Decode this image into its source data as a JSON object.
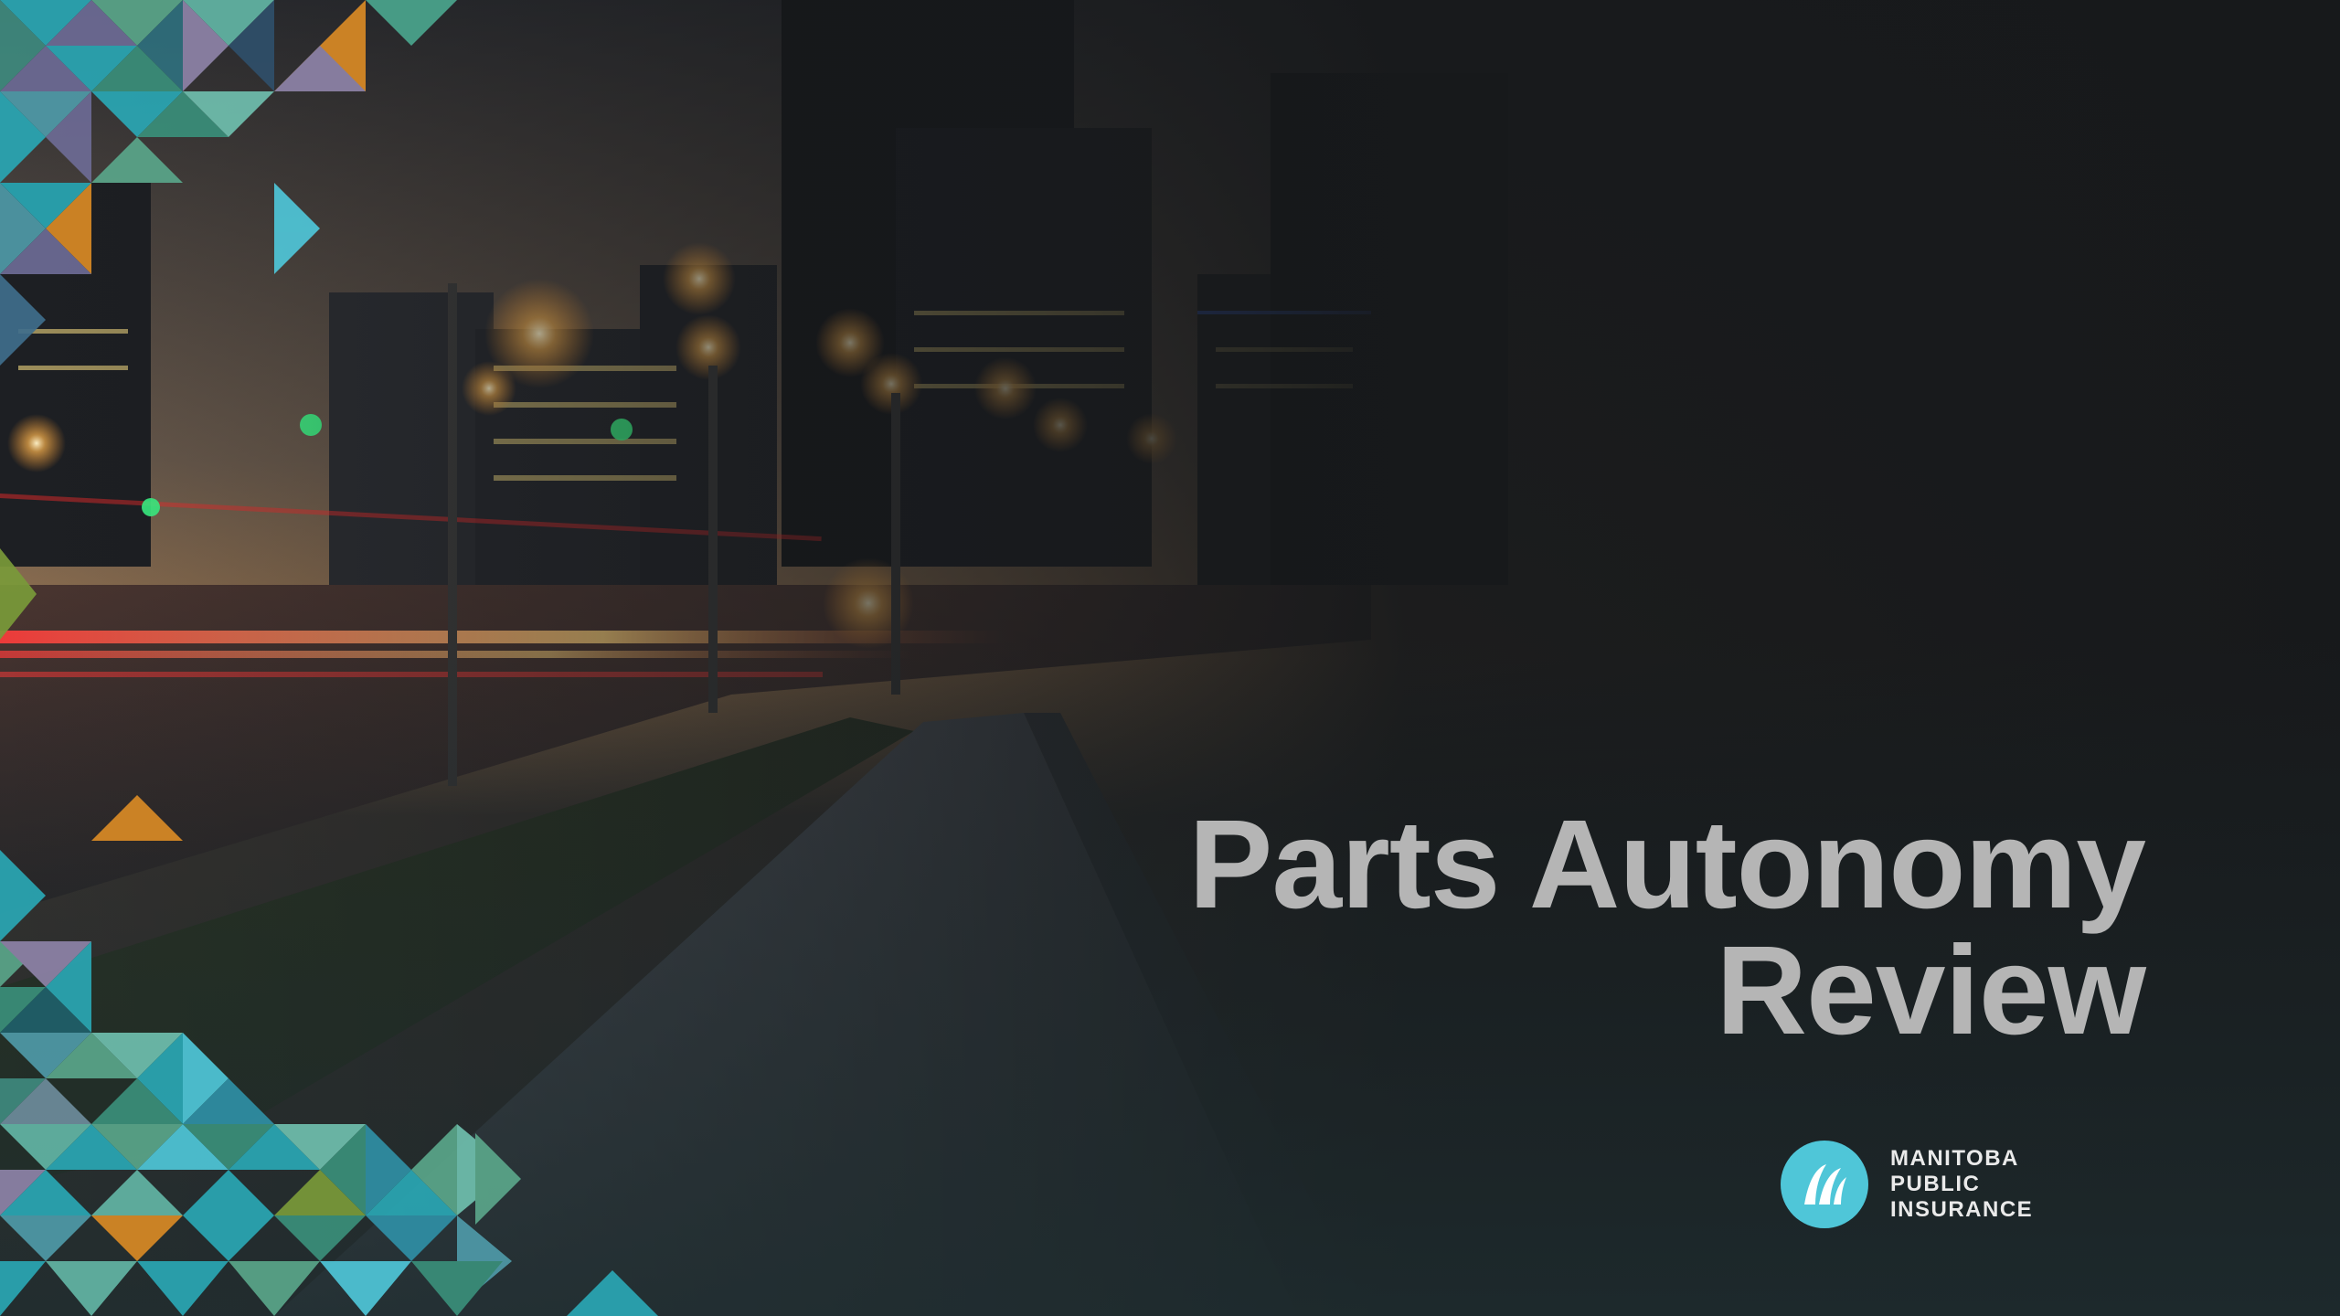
{
  "slide": {
    "title_line1": "Parts Autonomy",
    "title_line2": "Review"
  },
  "logo": {
    "line1": "MANITOBA",
    "line2": "PUBLIC INSURANCE",
    "icon": "mpi-logo-icon",
    "color": "#4fc6d8"
  },
  "colors": {
    "background": "#17191b",
    "title": "#b5b5b5",
    "accent_teal": "#2aa7b4",
    "accent_orange": "#d98a25"
  }
}
